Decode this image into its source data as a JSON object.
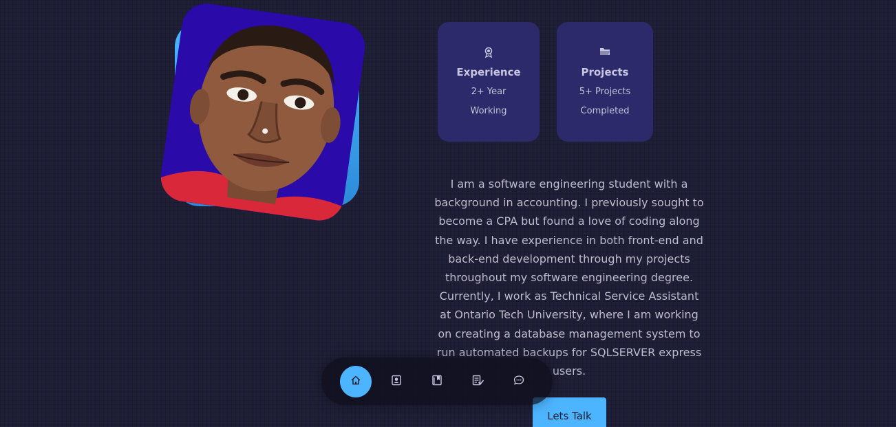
{
  "about": {
    "cards": [
      {
        "icon": "award-icon",
        "title": "Experience",
        "sub": "2+ Year Working"
      },
      {
        "icon": "folder-icon",
        "title": "Projects",
        "sub": "5+ Projects Completed"
      }
    ],
    "bio": "I am a software engineering student with a background in accounting. I previously sought to become a CPA but found a love of coding along the way. I have experience in both front-end and back-end development through my projects throughout my software engineering degree. Currently, I work as Technical Service Assistant at Ontario Tech University, where I am working on creating a database management system to run automated backups for SQLSERVER express users.",
    "cta_label": "Lets Talk"
  },
  "nav": {
    "items": [
      {
        "icon": "home-icon",
        "active": true
      },
      {
        "icon": "user-icon",
        "active": false
      },
      {
        "icon": "book-icon",
        "active": false
      },
      {
        "icon": "services-icon",
        "active": false
      },
      {
        "icon": "message-icon",
        "active": false
      }
    ]
  },
  "colors": {
    "background": "#1f1f38",
    "accent": "#4db5ff",
    "card": "#2c2a6a",
    "portrait_bg": "#2a0aa8"
  }
}
